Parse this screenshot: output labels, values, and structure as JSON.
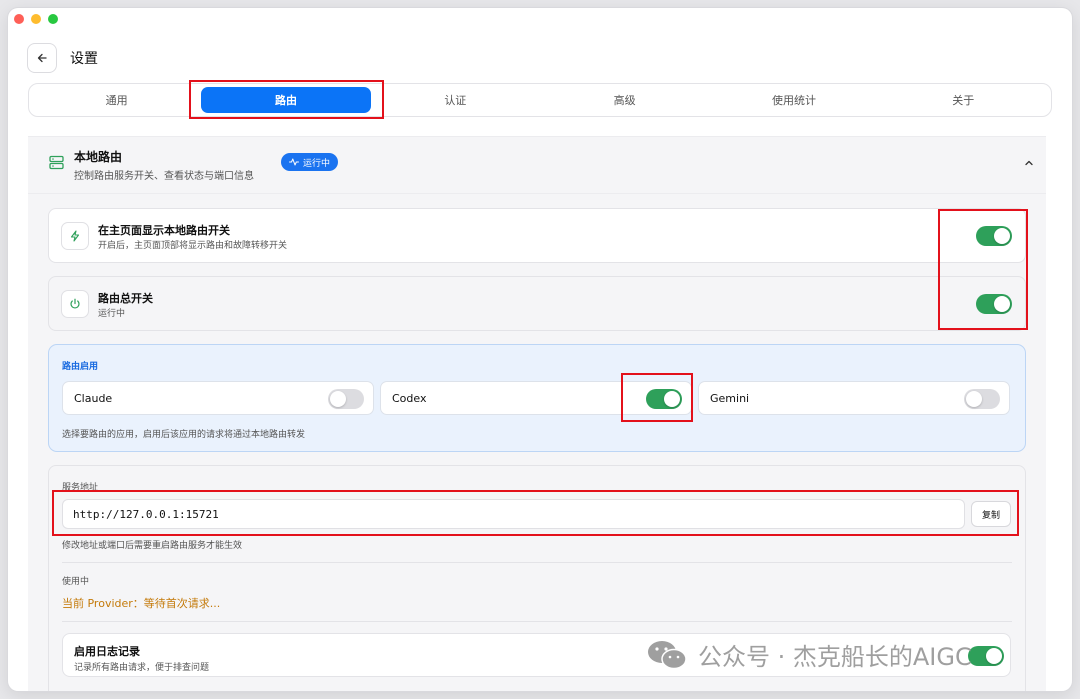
{
  "header": {
    "title": "设置"
  },
  "tabs": [
    {
      "label": "通用",
      "active": false
    },
    {
      "label": "路由",
      "active": true
    },
    {
      "label": "认证",
      "active": false
    },
    {
      "label": "高级",
      "active": false
    },
    {
      "label": "使用统计",
      "active": false
    },
    {
      "label": "关于",
      "active": false
    }
  ],
  "section": {
    "title": "本地路由",
    "subtitle": "控制路由服务开关、查看状态与端口信息",
    "badge": "运行中",
    "expanded": true
  },
  "rows": [
    {
      "title": "在主页面显示本地路由开关",
      "subtitle": "开启后，主页面顶部将显示路由和故障转移开关",
      "icon": "lightning-icon",
      "enabled": true
    },
    {
      "title": "路由总开关",
      "subtitle": "运行中",
      "icon": "power-icon",
      "enabled": true
    }
  ],
  "routing": {
    "title": "路由启用",
    "apps": [
      {
        "name": "Claude",
        "enabled": false
      },
      {
        "name": "Codex",
        "enabled": true
      },
      {
        "name": "Gemini",
        "enabled": false
      }
    ],
    "hint": "选择要路由的应用，启用后该应用的请求将通过本地路由转发"
  },
  "server": {
    "label": "服务地址",
    "address": "http://127.0.0.1:15721",
    "copy_label": "复制",
    "hint": "修改地址或端口后需要重启路由服务才能生效",
    "in_use_label": "使用中",
    "provider_text": "当前 Provider：等待首次请求..."
  },
  "logging": {
    "title": "启用日志记录",
    "subtitle": "记录所有路由请求，便于排查问题",
    "enabled": true
  },
  "watermark": {
    "text": "公众号 · 杰克船长的AIGC"
  },
  "colors": {
    "accent": "#0b74f7",
    "toggle_on": "#2ea05a",
    "highlight": "#e3111b",
    "provider": "#c47a0a"
  }
}
